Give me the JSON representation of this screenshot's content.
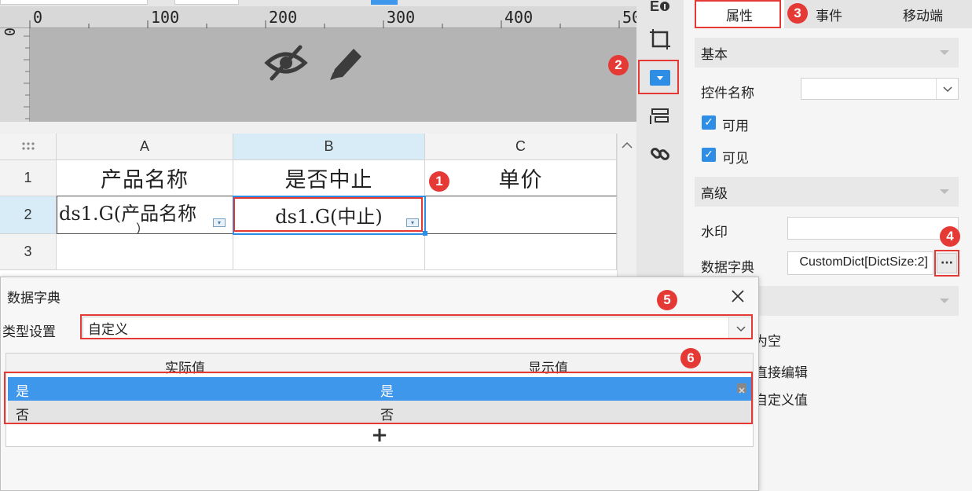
{
  "ruler": {
    "h_ticks": [
      "0",
      "100",
      "200",
      "300",
      "400",
      "50"
    ],
    "v_tick": "0"
  },
  "canvas_icons": {
    "hidden": "eye-slash-icon",
    "edit": "pencil-icon"
  },
  "grid": {
    "columns": [
      "A",
      "B",
      "C"
    ],
    "rows": [
      "1",
      "2",
      "3"
    ],
    "cells": {
      "A1": "产品名称",
      "B1": "是否中止",
      "C1": "单价",
      "A2": "ds1.G(产品名称",
      "A2_wrap": "）",
      "B2": "ds1.G(中止)"
    }
  },
  "toolbar": {
    "icons": [
      "widget-settings-icon",
      "frame-icon",
      "dropdown-widget-icon",
      "layer-icon",
      "link-icon"
    ]
  },
  "panel": {
    "tabs": [
      "属性",
      "事件",
      "移动端"
    ],
    "basic": "基本",
    "control_name_label": "控件名称",
    "control_name_value": "",
    "enabled_label": "可用",
    "visible_label": "可见",
    "advanced": "高级",
    "watermark_label": "水印",
    "watermark_value": "",
    "dict_label": "数据字典",
    "dict_value": "CustomDict[DictSize:2]",
    "dict_button": "···",
    "partial_1": "为空",
    "partial_2": "直接编辑",
    "partial_3": "自定义值"
  },
  "dialog": {
    "title": "数据字典",
    "type_label": "类型设置",
    "type_value": "自定义",
    "col_actual": "实际值",
    "col_display": "显示值",
    "rows": [
      {
        "actual": "是",
        "display": "是"
      },
      {
        "actual": "否",
        "display": "否"
      }
    ],
    "add": "+"
  },
  "markers": [
    "1",
    "2",
    "3",
    "4",
    "5",
    "6"
  ],
  "colors": {
    "accent": "#2e8ee6",
    "selected_row": "#3f97ec",
    "marker": "#e53935"
  }
}
